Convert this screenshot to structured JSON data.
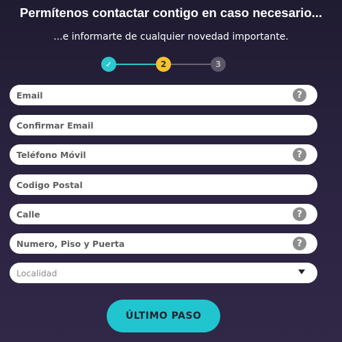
{
  "header": {
    "title": "Permítenos contactar contigo en caso necesario...",
    "subtitle": "...e informarte de cualquier novedad importante."
  },
  "stepper": {
    "steps": [
      {
        "label": "✓",
        "state": "completed"
      },
      {
        "label": "2",
        "state": "current"
      },
      {
        "label": "3",
        "state": "upcoming"
      }
    ],
    "colors": {
      "completed": "#2cc7cf",
      "current": "#f5c331",
      "upcoming": "#5c5668"
    }
  },
  "form": {
    "fields": [
      {
        "label": "Email",
        "has_help": true
      },
      {
        "label": "Confirmar Email",
        "has_help": false
      },
      {
        "label": "Teléfono Móvil",
        "has_help": true
      },
      {
        "label": "Codigo Postal",
        "has_help": false
      },
      {
        "label": "Calle",
        "has_help": true
      },
      {
        "label": "Numero, Piso y Puerta",
        "has_help": true
      },
      {
        "label": "Localidad",
        "type": "select"
      }
    ],
    "help_glyph": "?",
    "submit_label": "ÚLTIMO PASO"
  },
  "colors": {
    "background": "#2a2340",
    "accent": "#20c5cf"
  }
}
